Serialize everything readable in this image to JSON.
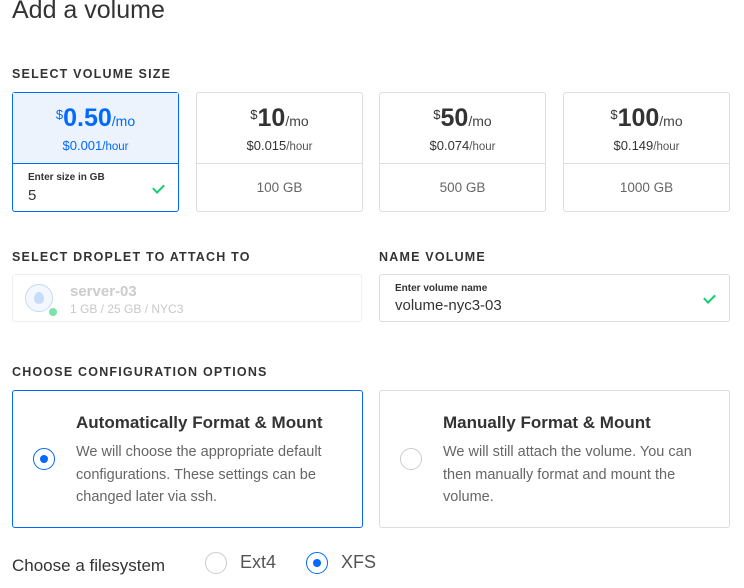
{
  "page": {
    "title": "Add a volume"
  },
  "size_section": {
    "label": "SELECT VOLUME SIZE",
    "options": [
      {
        "currency": "$",
        "amount": "0.50",
        "per": "/mo",
        "hourly_amount": "$0.001",
        "hourly_unit": "/hour",
        "input_label": "Enter size in GB",
        "input_value": "5",
        "selected": true
      },
      {
        "currency": "$",
        "amount": "10",
        "per": "/mo",
        "hourly_amount": "$0.015",
        "hourly_unit": "/hour",
        "size": "100 GB",
        "selected": false
      },
      {
        "currency": "$",
        "amount": "50",
        "per": "/mo",
        "hourly_amount": "$0.074",
        "hourly_unit": "/hour",
        "size": "500 GB",
        "selected": false
      },
      {
        "currency": "$",
        "amount": "100",
        "per": "/mo",
        "hourly_amount": "$0.149",
        "hourly_unit": "/hour",
        "size": "1000 GB",
        "selected": false
      }
    ]
  },
  "droplet_section": {
    "label": "SELECT DROPLET TO ATTACH TO",
    "droplet": {
      "name": "server-03",
      "meta": "1 GB / 25 GB / NYC3",
      "icon": "droplet-icon"
    }
  },
  "name_section": {
    "label": "NAME VOLUME",
    "input_label": "Enter volume name",
    "value": "volume-nyc3-03"
  },
  "config_section": {
    "label": "CHOOSE CONFIGURATION OPTIONS",
    "options": [
      {
        "title": "Automatically Format & Mount",
        "description": "We will choose the appropriate default configurations. These settings can be changed later via ssh.",
        "selected": true
      },
      {
        "title": "Manually Format & Mount",
        "description": "We will still attach the volume. You can then manually format and mount the volume.",
        "selected": false
      }
    ]
  },
  "filesystem": {
    "label": "Choose a filesystem",
    "options": [
      {
        "label": "Ext4",
        "selected": false
      },
      {
        "label": "XFS",
        "selected": true
      }
    ]
  },
  "colors": {
    "accent": "#0069ff",
    "success": "#15cd72",
    "border": "#dddddd"
  }
}
